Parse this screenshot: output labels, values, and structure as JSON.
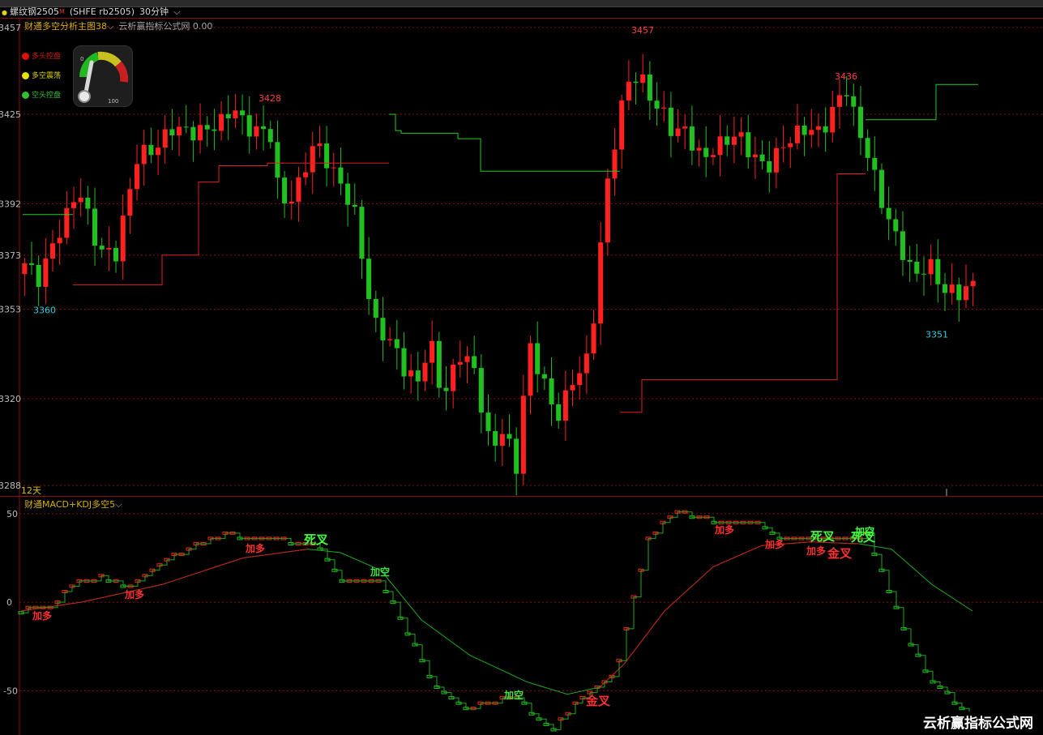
{
  "header": {
    "instrument": "螺纹钢2505",
    "mark": "M",
    "code": "(SHFE rb2505)",
    "period": "30分钟",
    "dropdown_glyph": "⌵"
  },
  "main_panel": {
    "indicator_name": "财通多空分析主图38",
    "indicator_extra": "云析赢指标公式网 0.00",
    "legend": [
      {
        "label": "多头控盘",
        "color": "#e01010"
      },
      {
        "label": "多空震荡",
        "color": "#e8e000"
      },
      {
        "label": "空头控盘",
        "color": "#30c030"
      }
    ],
    "gauge": {
      "min_label": "0",
      "max_label": "100",
      "value": 0.12
    },
    "days_label": "12天",
    "y_ticks": [
      3457,
      3425,
      3392,
      3373,
      3353,
      3320,
      3288
    ],
    "price_labels": [
      {
        "text": "3457",
        "color": "#ff4040"
      },
      {
        "text": "3428",
        "color": "#ff4040"
      },
      {
        "text": "3436",
        "color": "#ff4040"
      },
      {
        "text": "3360",
        "color": "#30d0e0"
      },
      {
        "text": "3288",
        "color": "#30d0e0"
      },
      {
        "text": "3351",
        "color": "#30d0e0"
      }
    ]
  },
  "sub_panel": {
    "indicator_name": "财通MACD+KDJ多空5",
    "y_ticks": [
      "50",
      "0",
      "-50"
    ],
    "signals": [
      {
        "text": "加多",
        "color": "#ff3030"
      },
      {
        "text": "加多",
        "color": "#ff3030"
      },
      {
        "text": "加多",
        "color": "#ff3030"
      },
      {
        "text": "死叉",
        "color": "#40ff40"
      },
      {
        "text": "加空",
        "color": "#40e040"
      },
      {
        "text": "加空",
        "color": "#40e040"
      },
      {
        "text": "金叉",
        "color": "#ff3030"
      },
      {
        "text": "加多",
        "color": "#ff3030"
      },
      {
        "text": "加多",
        "color": "#ff3030"
      },
      {
        "text": "死叉",
        "color": "#40ff40"
      },
      {
        "text": "加多",
        "color": "#ff3030"
      },
      {
        "text": "金叉",
        "color": "#ff3030"
      },
      {
        "text": "死叉",
        "color": "#40ff40"
      },
      {
        "text": "加空",
        "color": "#40ff40"
      }
    ]
  },
  "watermark": "云析赢指标公式网",
  "colors": {
    "up": "#ff2020",
    "down": "#20c020",
    "grid": "#8a1010",
    "background": "#000000"
  }
}
